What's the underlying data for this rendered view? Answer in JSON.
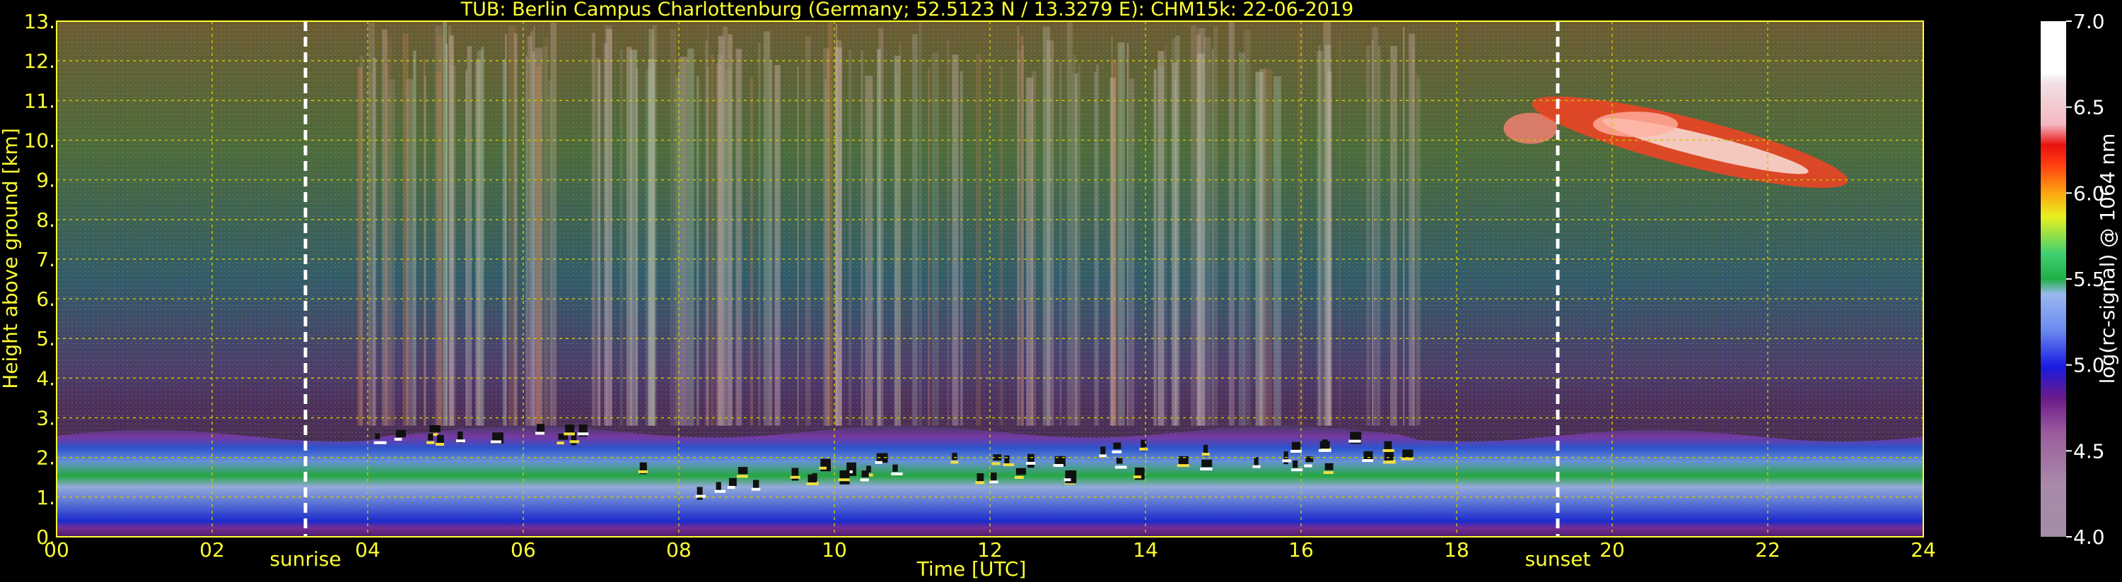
{
  "chart_data": {
    "type": "heatmap",
    "title": "TUB: Berlin Campus Charlottenburg (Germany; 52.5123 N / 13.3279 E):    CHM15k: 22-06-2019",
    "xlabel": "Time [UTC]",
    "ylabel": "Height above ground [km]",
    "xlim": [
      0,
      24
    ],
    "ylim": [
      0,
      13
    ],
    "x_ticks": [
      "00",
      "02",
      "04",
      "06",
      "08",
      "10",
      "12",
      "14",
      "16",
      "18",
      "20",
      "22",
      "24"
    ],
    "y_ticks": [
      "0.",
      "1.",
      "2.",
      "3.",
      "4.",
      "5.",
      "6.",
      "7.",
      "8.",
      "9.",
      "10.",
      "11.",
      "12.",
      "13."
    ],
    "grid": true,
    "markers": [
      {
        "label": "sunrise",
        "x": 3.2
      },
      {
        "label": "sunset",
        "x": 19.3
      }
    ],
    "colorbar": {
      "label": "log(rc-signal) @ 1064 nm",
      "range": [
        4.0,
        7.0
      ],
      "ticks": [
        "4.0",
        "4.5",
        "5.0",
        "5.5",
        "6.0",
        "6.5",
        "7.0"
      ]
    },
    "features": [
      {
        "name": "boundary-layer",
        "x": [
          0,
          24
        ],
        "height_km": [
          0.0,
          2.8
        ]
      },
      {
        "name": "cirrus",
        "x": [
          18.5,
          22.5
        ],
        "height_km": [
          9.0,
          11.0
        ]
      }
    ]
  },
  "colors": {
    "axis_text": "#ffff33",
    "grid": "#c8c800",
    "marker": "#ffffff",
    "background": "#000000"
  }
}
